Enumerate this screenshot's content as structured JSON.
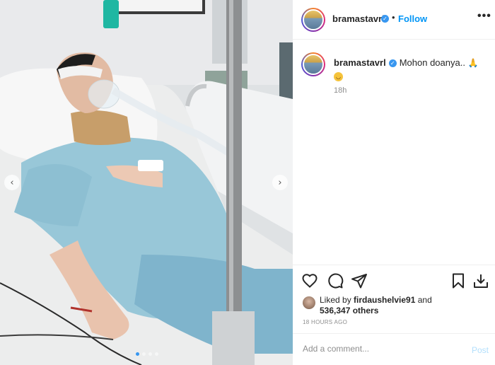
{
  "post": {
    "username": "bramastavrl",
    "separator": "•",
    "follow_label": "Follow",
    "more_label": "•••",
    "verified_glyph": "✓"
  },
  "caption": {
    "username": "bramastavrl",
    "text": "Mohon doanya..",
    "emoji_pray": "🙏",
    "emoji_face": "😷",
    "time": "18h"
  },
  "engagement": {
    "liked_prefix": "Liked by ",
    "liked_user": "firdaushelvie91",
    "liked_mid": " and",
    "liked_count": "536,347 others",
    "posted_ago": "18 HOURS AGO"
  },
  "comment": {
    "placeholder": "Add a comment...",
    "post_label": "Post"
  },
  "carousel": {
    "prev_glyph": "‹",
    "next_glyph": "›",
    "slide_count": 4,
    "active_slide": 1
  },
  "icons": [
    "heart-icon",
    "comment-icon",
    "share-icon",
    "bookmark-icon",
    "download-icon",
    "verified-badge-icon",
    "more-options-icon"
  ],
  "colors": {
    "accent": "#0095f6",
    "verified": "#3897f0",
    "muted": "#8e8e8e"
  }
}
